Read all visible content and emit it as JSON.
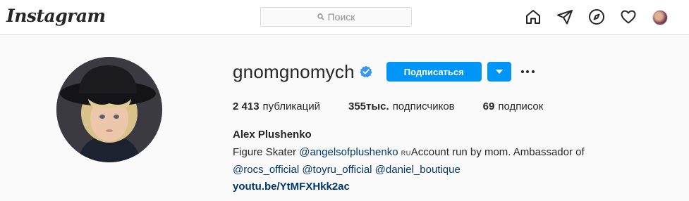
{
  "header": {
    "logo": "Instagram",
    "search_placeholder": "Поиск",
    "icons": [
      "home-icon",
      "direct-icon",
      "explore-icon",
      "activity-heart-icon",
      "profile-avatar"
    ]
  },
  "profile": {
    "username": "gnomgnomych",
    "verified": true,
    "follow_label": "Подписаться",
    "stats": [
      {
        "value": "2 413",
        "label": "публикаций"
      },
      {
        "value": "355тыс.",
        "label": "подписчиков"
      },
      {
        "value": "69",
        "label": "подписок"
      }
    ],
    "full_name": "Alex Plushenko",
    "bio": {
      "line1_prefix": "Figure Skater ",
      "mention1": "@angelsofplushenko",
      "flag": "RU",
      "line1_suffix": "Account run by mom. Ambassador of",
      "mention2": "@rocs_official",
      "mention3": "@toyru_official",
      "mention4": "@daniel_boutique",
      "link": "youtu.be/YtMFXHkk2ac"
    }
  },
  "colors": {
    "accent": "#0095f6",
    "link": "#00376b",
    "text": "#262626",
    "background": "#fafafa"
  }
}
